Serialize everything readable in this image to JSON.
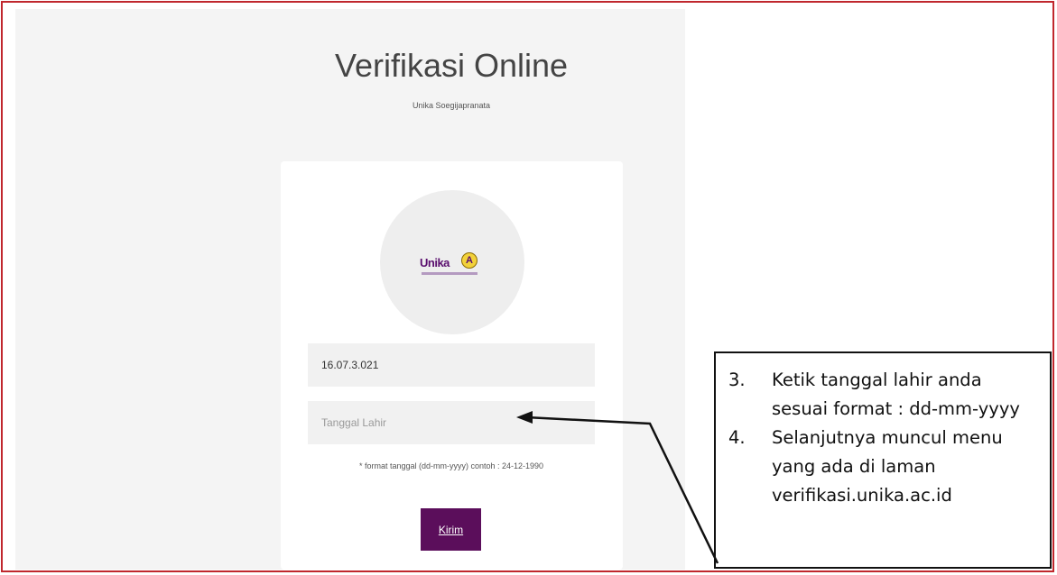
{
  "header": {
    "title": "Verifikasi Online",
    "subtitle": "Unika Soegijapranata"
  },
  "logo": {
    "text": "Unika",
    "badge": "A",
    "icon": "unika-logo"
  },
  "form": {
    "nim_value": "16.07.3.021",
    "dob_placeholder": "Tanggal Lahir",
    "hint": "* format tanggal (dd-mm-yyyy) contoh : 24-12-1990",
    "submit_label": "Kirim"
  },
  "annotation": {
    "items": [
      {
        "number": "3.",
        "text": "Ketik tanggal lahir anda sesuai format : dd-mm-yyyy"
      },
      {
        "number": "4.",
        "text": "Selanjutnya muncul menu yang ada di laman verifikasi.unika.ac.id"
      }
    ]
  },
  "colors": {
    "frame_border": "#c0272d",
    "submit_bg": "#5b0e5b",
    "logo_purple": "#5a0f6e",
    "logo_badge": "#f2d13a"
  }
}
